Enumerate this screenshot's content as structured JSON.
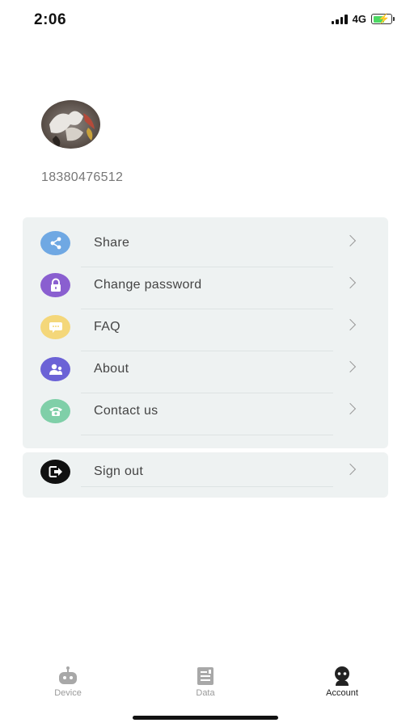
{
  "status_bar": {
    "time": "2:06",
    "network": "4G"
  },
  "profile": {
    "phone": "18380476512"
  },
  "menu": {
    "items": [
      {
        "label": "Share",
        "icon": "share-icon",
        "color": "#6fa8e3"
      },
      {
        "label": "Change password",
        "icon": "lock-icon",
        "color": "#8a5fd0"
      },
      {
        "label": "FAQ",
        "icon": "chat-icon",
        "color": "#f4d77a"
      },
      {
        "label": "About",
        "icon": "about-icon",
        "color": "#6b62d6"
      },
      {
        "label": "Contact us",
        "icon": "phone-icon",
        "color": "#7fcfa8"
      }
    ],
    "sign_out": {
      "label": "Sign out",
      "icon": "sign-out-icon",
      "color": "#111111"
    }
  },
  "tab_bar": {
    "tabs": [
      {
        "label": "Device",
        "icon": "robot-icon"
      },
      {
        "label": "Data",
        "icon": "document-icon"
      },
      {
        "label": "Account",
        "icon": "account-icon"
      }
    ],
    "active_tab": "Account"
  }
}
